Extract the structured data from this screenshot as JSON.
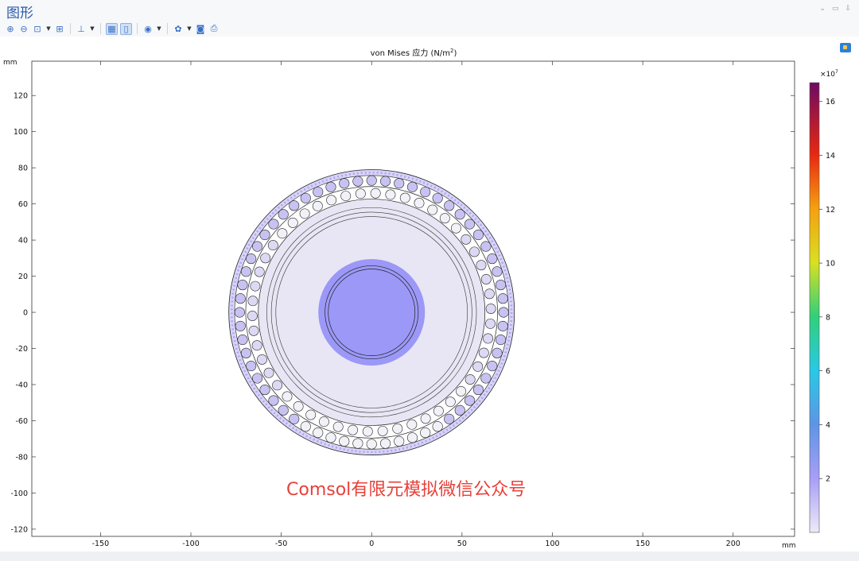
{
  "window": {
    "title": "图形"
  },
  "toolbar": {
    "buttons": [
      {
        "name": "zoom-in-icon",
        "glyph": "⊕"
      },
      {
        "name": "zoom-out-icon",
        "glyph": "⊖"
      },
      {
        "name": "zoom-box-icon",
        "glyph": "⊡"
      },
      {
        "name": "zoom-extents-icon",
        "glyph": "⊞"
      },
      {
        "name": "axis-orientation-icon",
        "glyph": "⊥"
      },
      {
        "name": "grid-toggle-icon",
        "glyph": "▦"
      },
      {
        "name": "show-legend-icon",
        "glyph": "▯"
      },
      {
        "name": "scene-light-icon",
        "glyph": "◉"
      },
      {
        "name": "render-settings-icon",
        "glyph": "✿"
      },
      {
        "name": "snapshot-camera-icon",
        "glyph": "◙"
      },
      {
        "name": "print-icon",
        "glyph": "⎙"
      }
    ]
  },
  "plot": {
    "title_main": "von Mises 应力 (N/m",
    "title_sup": "2",
    "title_end": ")",
    "y_unit": "mm",
    "x_unit": "mm",
    "x_ticks": [
      "-150",
      "-100",
      "-50",
      "0",
      "50",
      "100",
      "150",
      "200"
    ],
    "y_ticks": [
      "120",
      "100",
      "80",
      "60",
      "40",
      "20",
      "0",
      "-20",
      "-40",
      "-60",
      "-80",
      "-100",
      "-120"
    ],
    "x_range": [
      -188,
      234
    ],
    "y_range": [
      -124,
      139
    ]
  },
  "colorbar": {
    "multiplier_base": "×10",
    "multiplier_exp": "7",
    "ticks": [
      "16",
      "14",
      "12",
      "10",
      "8",
      "6",
      "4",
      "2"
    ],
    "range": [
      0,
      16.7
    ]
  },
  "model": {
    "outer_sheath_radius_mm": 79,
    "armor_wire_ring_radius_mm": 73,
    "armor_wire_count": 60,
    "inner_wire_ring_radius_mm": 66,
    "inner_wire_count": 50,
    "conductor_radius_mm": 28,
    "highlight_color": "#9c98f8",
    "body_color": "#e8e6f4",
    "wire_fill_light": "#f2f1f8",
    "wire_fill_tinted": "#c8c2f2"
  },
  "watermark": {
    "text": "Comsol有限元模拟微信公众号",
    "color": "#e8403a"
  }
}
